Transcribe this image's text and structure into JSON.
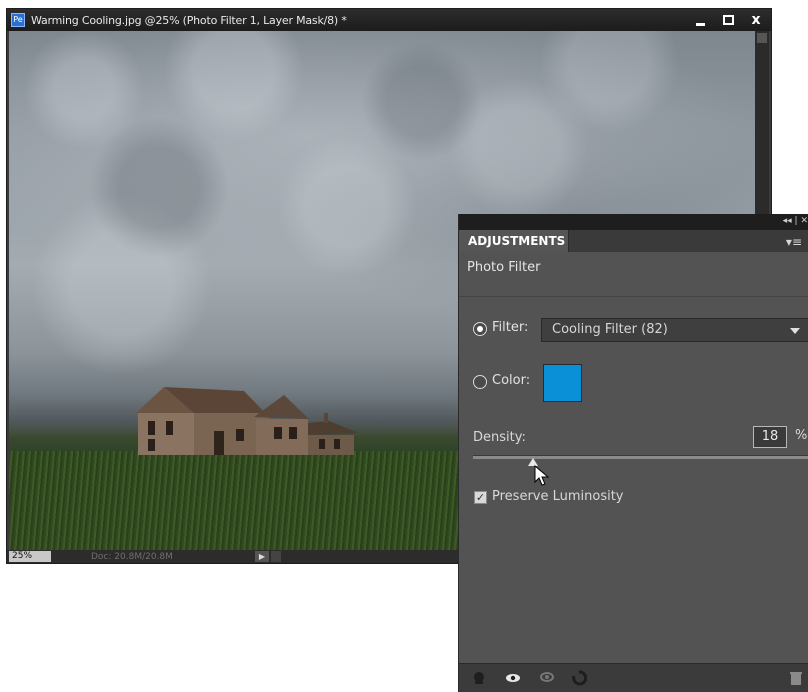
{
  "document": {
    "title": "Warming Cooling.jpg @25% (Photo Filter 1, Layer Mask/8) *",
    "app_icon": "Pe",
    "window_controls": {
      "minimize_icon": "minimize-icon",
      "maximize_icon": "maximize-icon",
      "close_label": "x"
    },
    "status": {
      "zoom": "25%",
      "doc_info": "Doc: 20.8M/20.8M",
      "arrow": "▶"
    }
  },
  "panel": {
    "topbar_controls": "◂◂ | ✕",
    "tab_label": "ADJUSTMENTS",
    "menu_icon": "▾≡",
    "heading": "Photo Filter",
    "filter": {
      "label": "Filter:",
      "selected": true,
      "value": "Cooling Filter (82)"
    },
    "color": {
      "label": "Color:",
      "selected": false,
      "swatch": "#0a90d6"
    },
    "density": {
      "label": "Density:",
      "value": "18",
      "unit": "%",
      "level": 0.18
    },
    "preserve_luminosity": {
      "label": "Preserve Luminosity",
      "checked": true,
      "check_mark": "✓"
    },
    "bottom_icons": [
      "clip-to-layer-icon",
      "visibility-eye-icon",
      "previous-state-icon",
      "reset-icon",
      "trash-icon"
    ]
  }
}
